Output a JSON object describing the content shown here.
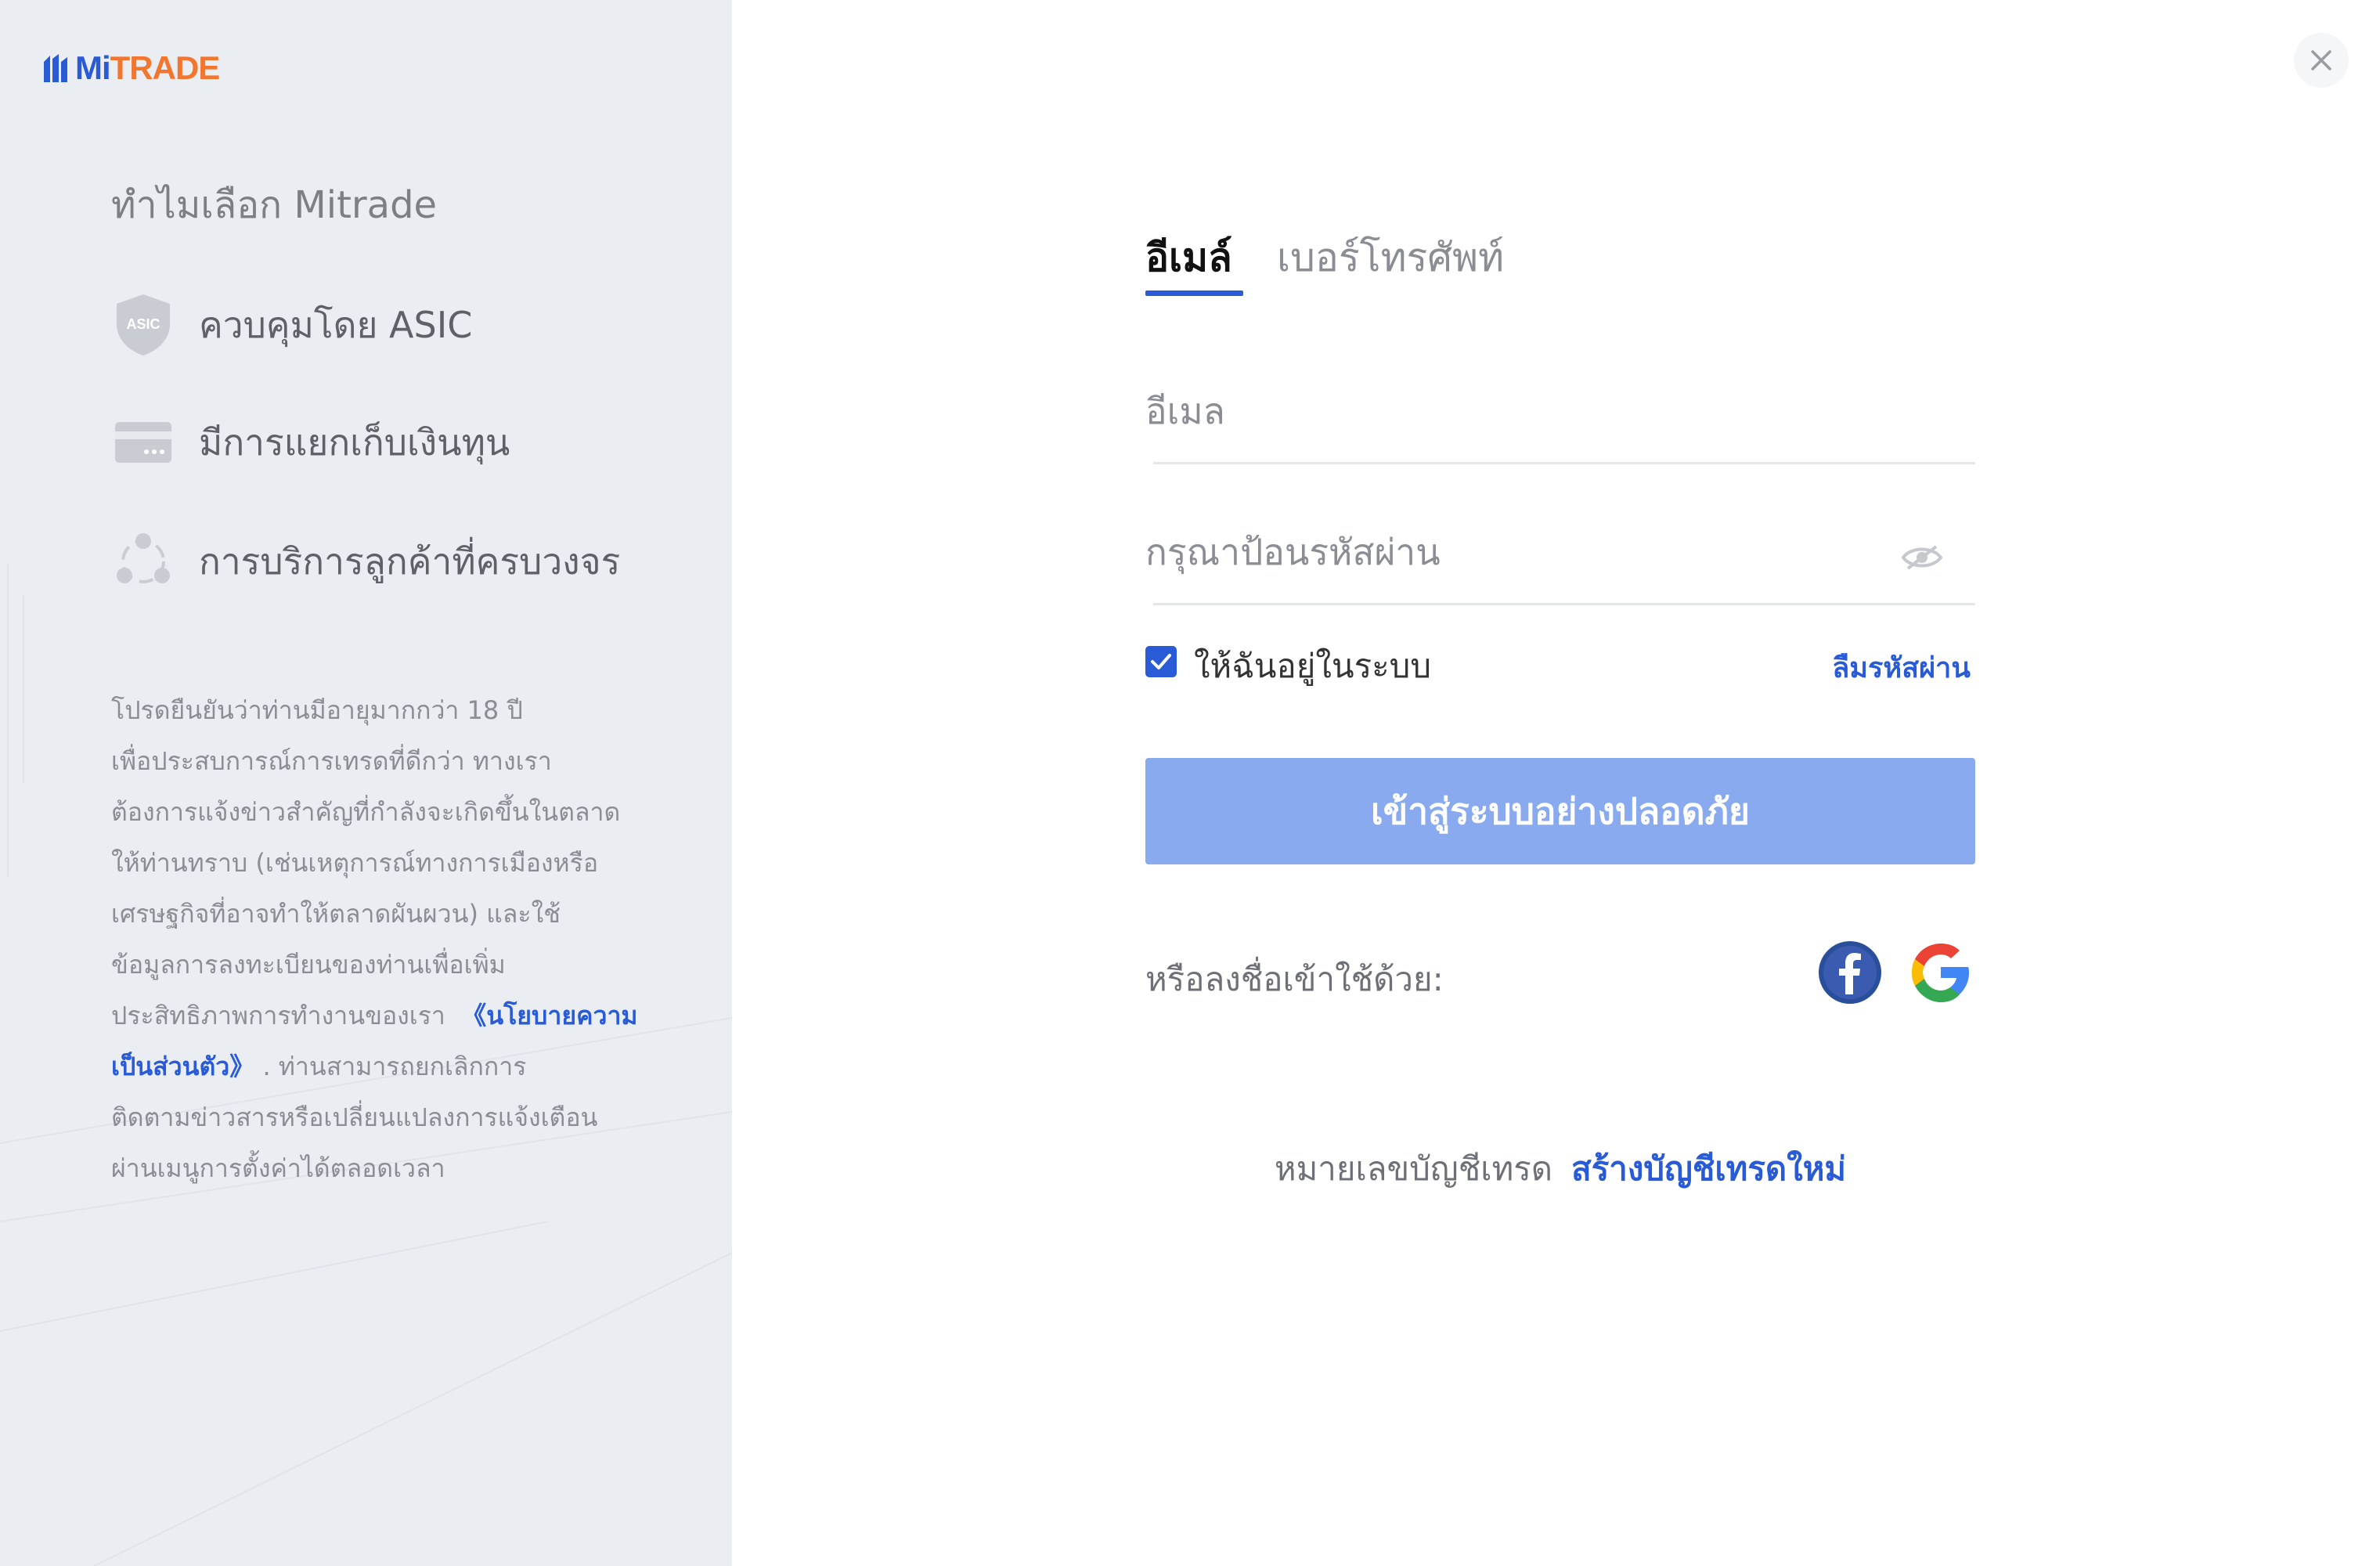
{
  "brand": {
    "logo_mi": "Mi",
    "logo_trade": "TRADE"
  },
  "left_panel": {
    "why_title": "ทำไมเลือก Mitrade",
    "features": [
      {
        "icon": "asic-shield-icon",
        "label": "ควบคุมโดย ASIC",
        "badge": "ASIC"
      },
      {
        "icon": "card-icon",
        "label": "มีการแยกเก็บเงินทุน"
      },
      {
        "icon": "people-network-icon",
        "label": "การบริการลูกค้าที่ครบวงจร"
      }
    ],
    "notice": {
      "line1": "โปรดยืนยันว่าท่านมีอายุมากกว่า 18 ปี",
      "line2": "เพื่อประสบการณ์การเทรดที่ดีกว่า ทางเรา",
      "line3": "ต้องการแจ้งข่าวสำคัญที่กำลังจะเกิดขึ้นในตลาด",
      "line4": "ให้ท่านทราบ (เช่นเหตุการณ์ทางการเมืองหรือ",
      "line5": "เศรษฐกิจที่อาจทำให้ตลาดผันผวน) และใช้",
      "line6": "ข้อมูลการลงทะเบียนของท่านเพื่อเพิ่ม",
      "line7": "ประสิทธิภาพการทำงานของเรา",
      "policy_link": "《นโยบายความเป็นส่วนตัว》",
      "line8": ". ท่านสามารถยกเลิกการ",
      "line9": "ติดตามข่าวสารหรือเปลี่ยนแปลงการแจ้งเตือน",
      "line10": "ผ่านเมนูการตั้งค่าได้ตลอดเวลา"
    }
  },
  "form": {
    "tabs": {
      "email": "อีเมล์",
      "phone": "เบอร์โทรศัพท์"
    },
    "email_placeholder": "อีเมล",
    "password_placeholder": "กรุณาป้อนรหัสผ่าน",
    "remember_label": "ให้ฉันอยู่ในระบบ",
    "remember_checked": true,
    "forgot_label": "ลืมรหัสผ่าน",
    "login_label": "เข้าสู่ระบบอย่างปลอดภัย",
    "social_label": "หรือลงชื่อเข้าใช้ด้วย:",
    "signup_question": "หมายเลขบัญชีเทรด",
    "signup_link": "สร้างบัญชีเทรดใหม่"
  },
  "colors": {
    "accent": "#2a5bd7",
    "brand_orange": "#f2762e",
    "button_disabled": "#8aaaf0",
    "left_bg": "#eaeef3"
  }
}
